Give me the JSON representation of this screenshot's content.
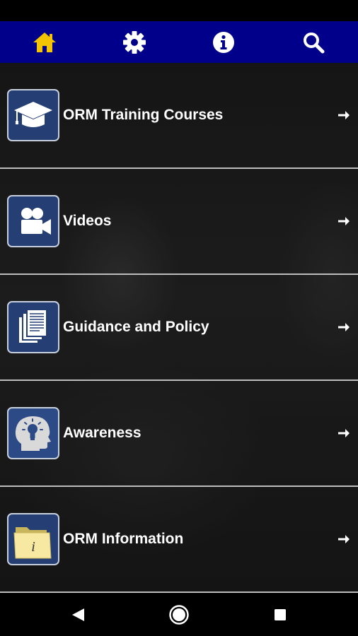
{
  "colors": {
    "nav_bg": "#00008b",
    "home_active": "#f5c400",
    "nav_icon": "#ffffff",
    "tile_bg": "#253f74"
  },
  "top_nav": [
    {
      "icon": "home-icon"
    },
    {
      "icon": "gear-icon"
    },
    {
      "icon": "info-icon"
    },
    {
      "icon": "search-icon"
    }
  ],
  "menu": [
    {
      "label": "ORM Training Courses",
      "icon": "graduation-cap-icon"
    },
    {
      "label": "Videos",
      "icon": "video-camera-icon"
    },
    {
      "label": "Guidance and Policy",
      "icon": "documents-icon"
    },
    {
      "label": "Awareness",
      "icon": "lightbulb-head-icon"
    },
    {
      "label": "ORM Information",
      "icon": "info-folder-icon"
    }
  ],
  "system_nav": [
    {
      "icon": "back-icon"
    },
    {
      "icon": "home-circle-icon"
    },
    {
      "icon": "recents-icon"
    }
  ]
}
